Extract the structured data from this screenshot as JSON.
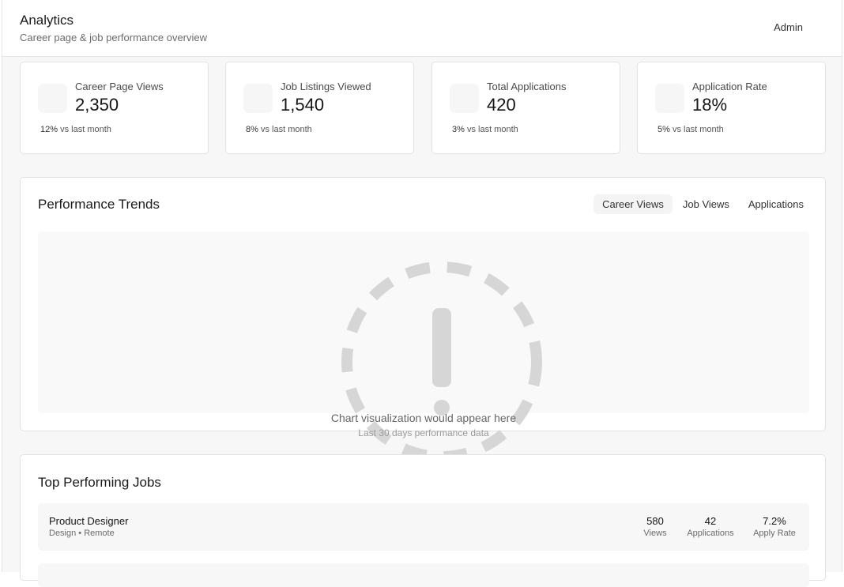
{
  "header": {
    "title": "Analytics",
    "subtitle": "Career page & job performance overview",
    "user": "Admin"
  },
  "stats": [
    {
      "label": "Career Page Views",
      "value": "2,350",
      "delta": "12%",
      "delta_suffix": "vs last month"
    },
    {
      "label": "Job Listings Viewed",
      "value": "1,540",
      "delta": "8%",
      "delta_suffix": "vs last month"
    },
    {
      "label": "Total Applications",
      "value": "420",
      "delta": "3%",
      "delta_suffix": "vs last month"
    },
    {
      "label": "Application Rate",
      "value": "18%",
      "delta": "5%",
      "delta_suffix": "vs last month"
    }
  ],
  "trends": {
    "title": "Performance Trends",
    "tabs": [
      "Career Views",
      "Job Views",
      "Applications"
    ],
    "active_tab": "Career Views",
    "placeholder_message": "Chart visualization would appear here",
    "placeholder_sub": "Last 30 days performance data"
  },
  "top_jobs": {
    "title": "Top Performing Jobs",
    "rows": [
      {
        "name": "Product Designer",
        "meta": "Design • Remote",
        "views": "580",
        "views_label": "Views",
        "applications": "42",
        "applications_label": "Applications",
        "apply_rate": "7.2%",
        "apply_rate_label": "Apply Rate"
      }
    ]
  },
  "colors": {
    "background": "#f7f7f7",
    "card": "#ffffff",
    "border": "#e2e2e2",
    "placeholder_icon": "#d6d6d6"
  },
  "icons": {
    "stat_icon": "stat-icon-placeholder",
    "chart_placeholder": "warning-circle-icon"
  }
}
